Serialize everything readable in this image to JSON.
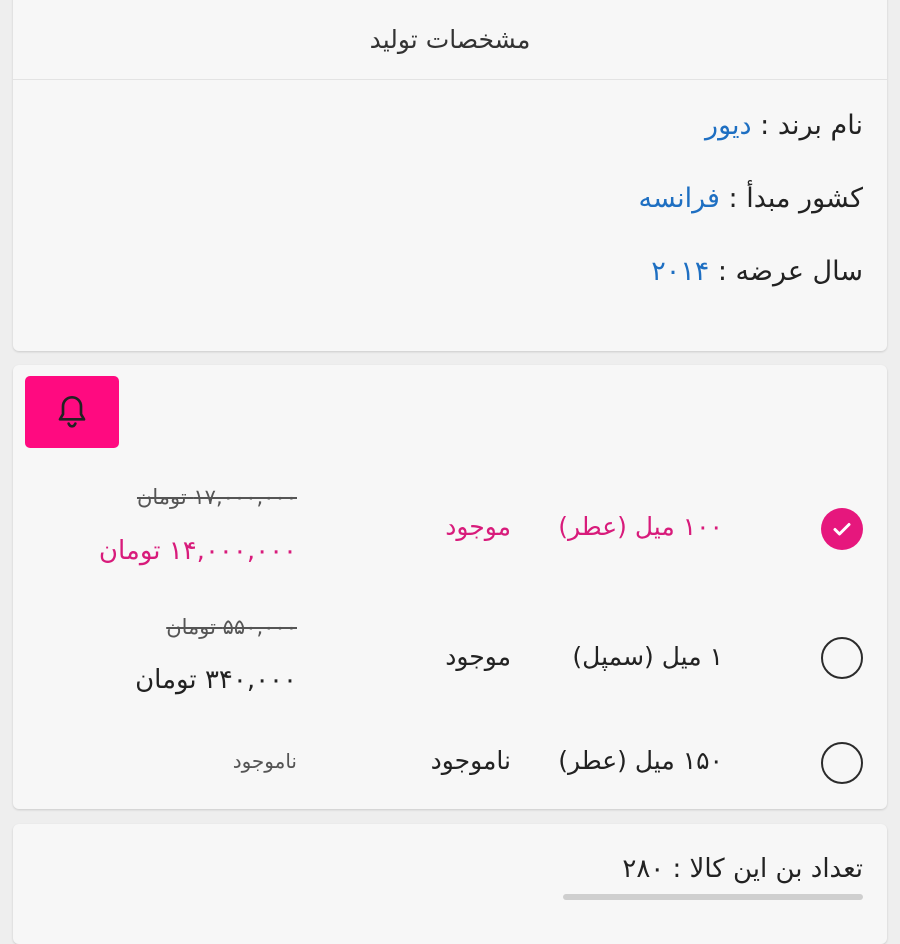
{
  "specs": {
    "title": "مشخصات تولید",
    "brand_label": "نام برند :",
    "brand_value": "دیور",
    "country_label": "کشور مبدأ :",
    "country_value": "فرانسه",
    "year_label": "سال عرضه :",
    "year_value": "۲۰۱۴"
  },
  "notify": {
    "icon": "bell-icon",
    "color": "#ff0a80"
  },
  "variants": [
    {
      "name": "۱۰۰ میل (عطر)",
      "stock": "موجود",
      "old_price": "۱۷,۰۰۰,۰۰۰ تومان",
      "price": "۱۴,۰۰۰,۰۰۰ تومان",
      "selected": true
    },
    {
      "name": "۱ میل (سمپل)",
      "stock": "موجود",
      "old_price": "۵۵۰,۰۰۰ تومان",
      "price": "۳۴۰,۰۰۰ تومان",
      "selected": false
    },
    {
      "name": "۱۵۰ میل (عطر)",
      "stock": "ناموجود",
      "unavailable_text": "ناموجود",
      "selected": false
    }
  ],
  "bonus": {
    "label": "تعداد بن این کالا :",
    "value": "۲۸۰"
  },
  "colors": {
    "accent": "#d81b7b",
    "link": "#1e6fc2"
  }
}
